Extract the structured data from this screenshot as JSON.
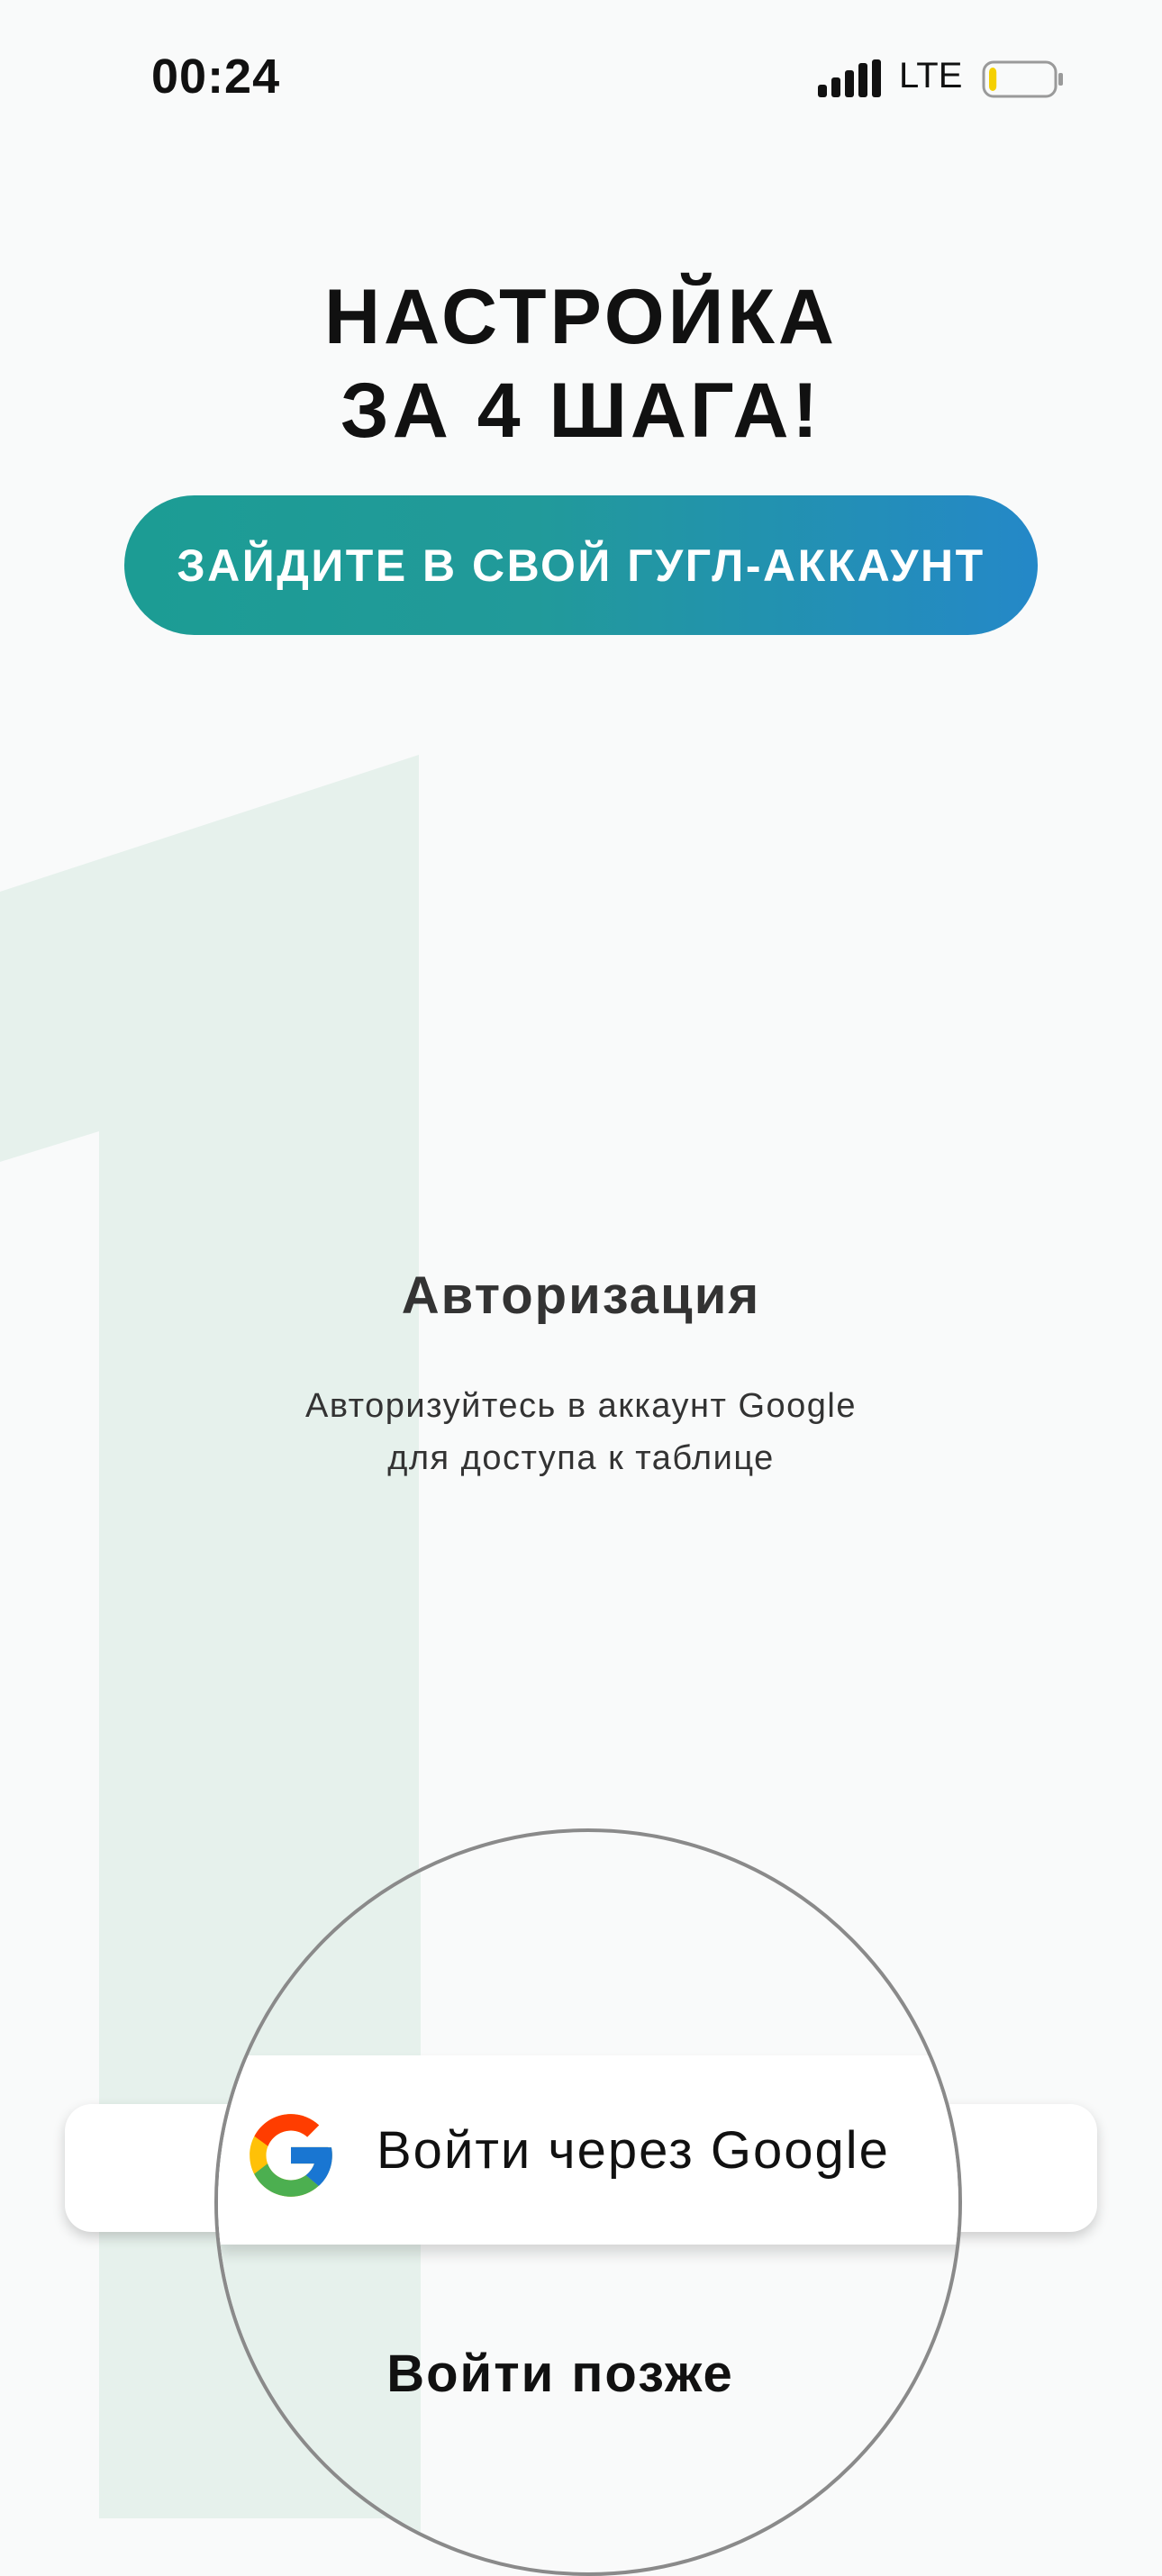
{
  "status_bar": {
    "time": "00:24",
    "network": "LTE",
    "signal_icon": "signal-bars-icon",
    "battery_icon": "battery-low-icon",
    "battery_level_fraction": 0.12,
    "battery_color": "#f5d000"
  },
  "header": {
    "title_line1": "НАСТРОЙКА",
    "title_line2": "ЗА 4 ШАГА!"
  },
  "step": {
    "banner_label": "ЗАЙДИТЕ В СВОЙ ГУГЛ-АККАУНТ",
    "number": "1",
    "gradient_start": "#1c9c94",
    "gradient_end": "#2488c8",
    "number_color": "#e6f1ec"
  },
  "auth": {
    "heading": "Авторизация",
    "description_line1": "Авторизуйтесь в аккаунт Google",
    "description_line2": "для доступа к таблице"
  },
  "actions": {
    "google_icon": "google-g-icon",
    "google_signin_label": "Войти через Google",
    "later_label": "Войти позже"
  }
}
